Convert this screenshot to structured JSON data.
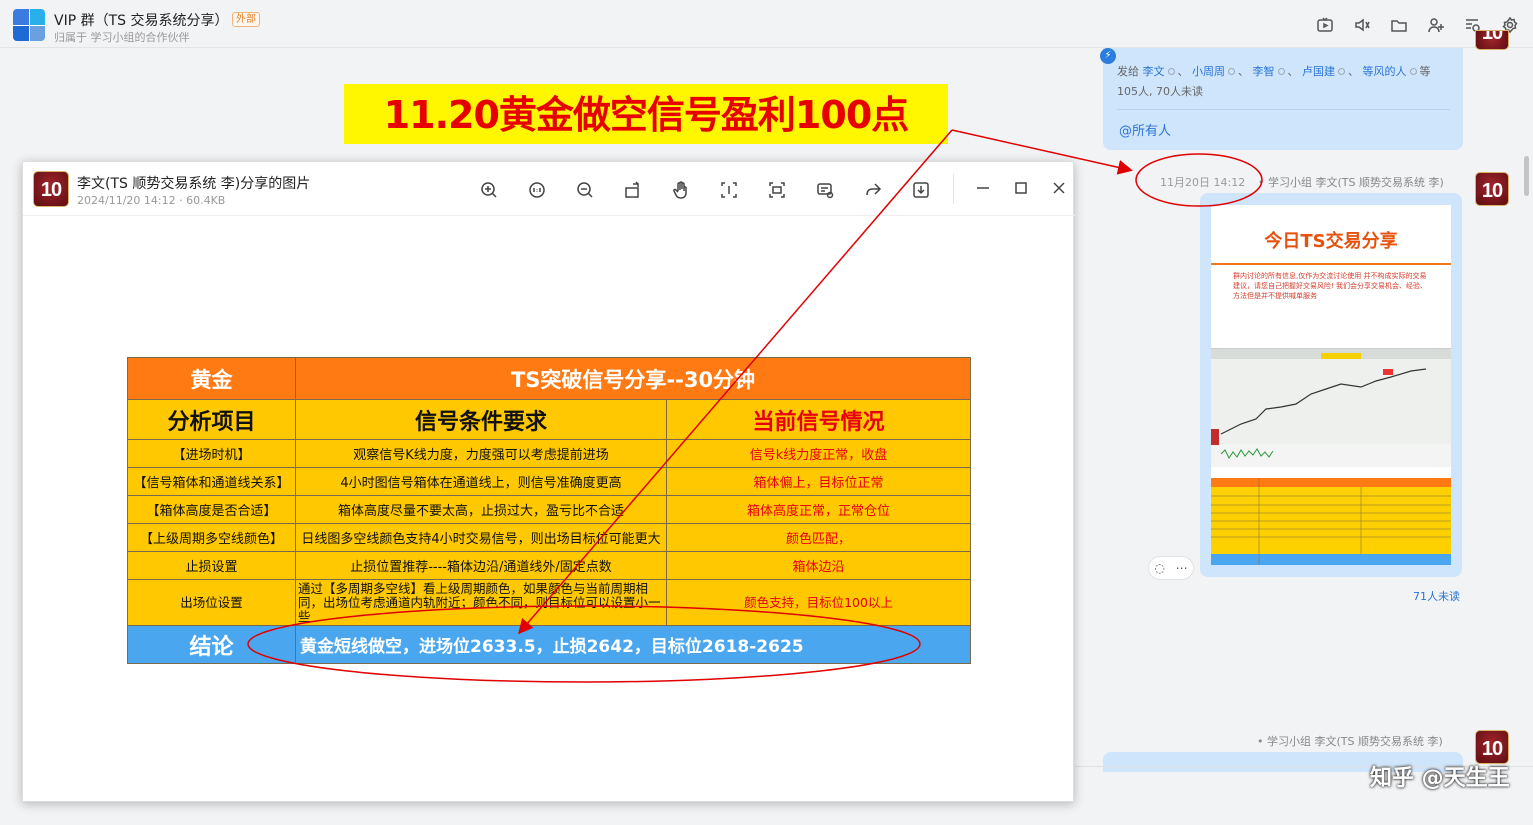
{
  "header": {
    "group_title": "VIP 群（TS 交易系统分享）",
    "external_tag": "外部",
    "subtitle": "归属于 学习小组的合作伙伴",
    "icons": [
      "live-icon",
      "speaker-icon",
      "folder-icon",
      "add-member-icon",
      "history-search-icon",
      "settings-icon"
    ]
  },
  "top_bubble": {
    "sent_to_label": "发给",
    "recipients": [
      "李文",
      "小周周",
      "李智",
      "卢国建",
      "等风的人"
    ],
    "suffix": "等",
    "read_status": "105人, 70人未读",
    "at_all": "@所有人"
  },
  "message": {
    "time": "11月20日 14:12",
    "sender": "• 学习小组  李文(TS 顺势交易系统 李)",
    "avatar_text": "10",
    "unread": "71人未读",
    "thumb_title": "今日TS交易分享",
    "thumb_text": "群内讨论的所有信息,仅作为交流讨论使用 并不构成实际的交易建议，请您自己把握好交易风险! 我们会分享交易机会、经验、方法但是并不提供喊单服务"
  },
  "message2": {
    "sender": "• 学习小组  李文(TS 顺势交易系统 李)"
  },
  "banner": {
    "text": "11.20黄金做空信号盈利100点"
  },
  "viewer": {
    "title": "李文(TS 顺势交易系统 李)分享的图片",
    "meta": "2024/11/20 14:12 · 60.4KB",
    "tool_icons": [
      "zoom-in-icon",
      "original-size-icon",
      "zoom-out-icon",
      "rotate-icon",
      "hand-icon",
      "crop-icon",
      "screenshot-icon",
      "extract-text-icon",
      "share-icon",
      "download-icon"
    ],
    "window_icons": [
      "minimize-icon",
      "maximize-icon",
      "close-icon"
    ]
  },
  "signal_table": {
    "asset": "黄金",
    "title": "TS突破信号分享--30分钟",
    "col_headers": [
      "分析项目",
      "信号条件要求",
      "当前信号情况"
    ],
    "rows": [
      [
        "【进场时机】",
        "观察信号K线力度，力度强可以考虑提前进场",
        "信号k线力度正常，收盘"
      ],
      [
        "【信号箱体和通道线关系】",
        "4小时图信号箱体在通道线上，则信号准确度更高",
        "箱体偏上，目标位正常"
      ],
      [
        "【箱体高度是否合适】",
        "箱体高度尽量不要太高，止损过大，盈亏比不合适",
        "箱体高度正常，正常仓位"
      ],
      [
        "【上级周期多空线颜色】",
        "日线图多空线颜色支持4小时交易信号，则出场目标位可能更大",
        "颜色匹配，"
      ],
      [
        "止损设置",
        "止损位置推荐----箱体边沿/通道线外/固定点数",
        "箱体边沿"
      ],
      [
        "出场位设置",
        "通过【多周期多空线】看上级周期颜色，如果颜色与当前周期相同，出场位考虑通道内轨附近；颜色不同，则目标位可以设置小一些",
        "颜色支持，目标位100以上"
      ]
    ],
    "conclusion_label": "结论",
    "conclusion": "黄金短线做空，进场位2633.5，止损2642，目标位2618-2625"
  },
  "watermark": "知乎 @天生王",
  "colors": {
    "table_orange": "#ff7a12",
    "table_yellow": "#ffc800",
    "table_blue": "#4aa6ef",
    "banner_yellow": "#fff700",
    "banner_red": "#e60000",
    "annotation_red": "#e00000",
    "bubble_blue": "#cfe5fb"
  }
}
